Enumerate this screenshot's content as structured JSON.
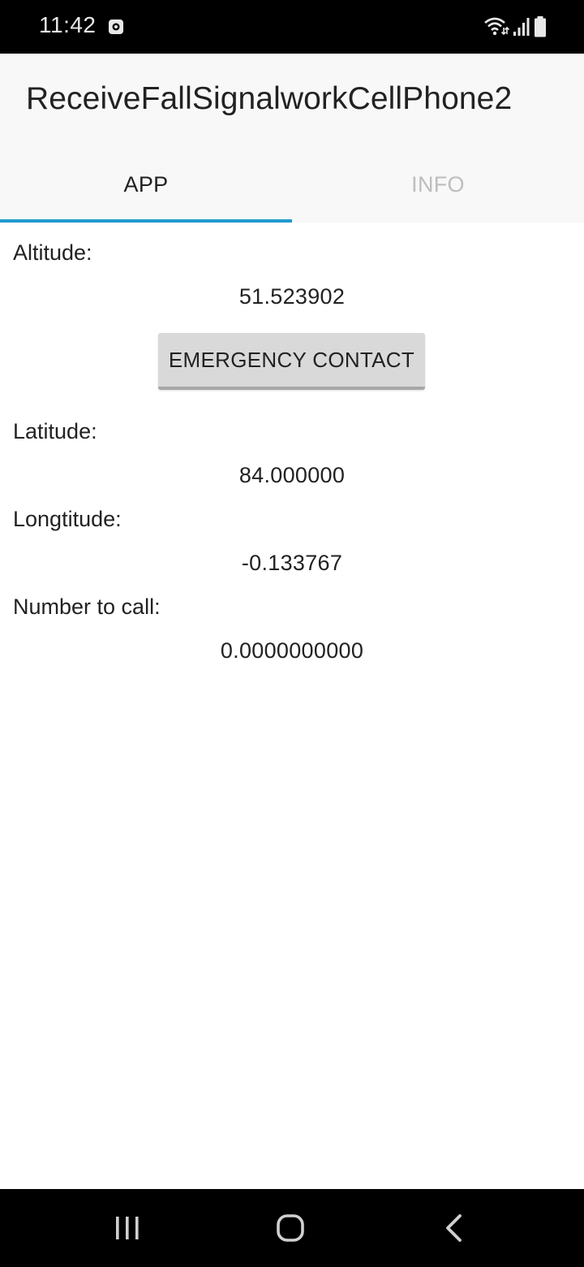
{
  "status_bar": {
    "time": "11:42",
    "icons": [
      "screen-record-icon",
      "wifi-icon",
      "signal-icon",
      "battery-icon"
    ]
  },
  "app_bar": {
    "title": "ReceiveFallSignalworkCellPhone2",
    "tabs": [
      {
        "label": "APP",
        "selected": true
      },
      {
        "label": "INFO",
        "selected": false
      }
    ],
    "accent_color": "#1f9bcf"
  },
  "fields": {
    "altitude": {
      "label": "Altitude:",
      "value": "51.523902"
    },
    "latitude": {
      "label": "Latitude:",
      "value": "84.000000"
    },
    "longitude": {
      "label": "Longtitude:",
      "value": "-0.133767"
    },
    "number_to_call": {
      "label": "Number to call:",
      "value": "0.0000000000"
    }
  },
  "emergency_button": {
    "label": "EMERGENCY CONTACT"
  },
  "nav_bar": {
    "buttons": [
      "recent-apps-icon",
      "home-icon",
      "back-icon"
    ]
  }
}
